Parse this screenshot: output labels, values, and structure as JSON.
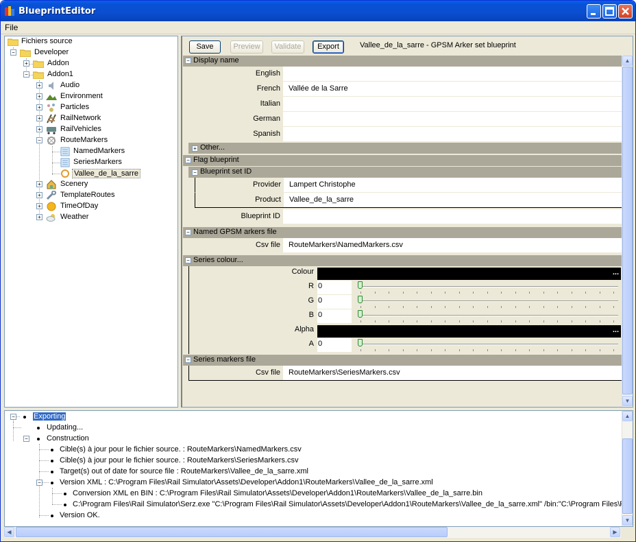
{
  "window": {
    "title": "BlueprintEditor"
  },
  "menu": {
    "file": "File"
  },
  "tree": {
    "root": "Fichiers source",
    "developer": "Developer",
    "addon": "Addon",
    "addon1": "Addon1",
    "items": [
      "Audio",
      "Environment",
      "Particles",
      "RailNetwork",
      "RailVehicles",
      "RouteMarkers"
    ],
    "route_children": [
      "NamedMarkers",
      "SeriesMarkers",
      "Vallee_de_la_sarre"
    ],
    "after": [
      "Scenery",
      "TemplateRoutes",
      "TimeOfDay",
      "Weather"
    ]
  },
  "toolbar": {
    "save": "Save",
    "preview": "Preview",
    "validate": "Validate",
    "export": "Export",
    "header": "Vallee_de_la_sarre - GPSM Arker set blueprint"
  },
  "grid": {
    "display_name": "Display name",
    "langs": [
      {
        "name": "English",
        "value": ""
      },
      {
        "name": "French",
        "value": "Vallée de la Sarre"
      },
      {
        "name": "Italian",
        "value": ""
      },
      {
        "name": "German",
        "value": ""
      },
      {
        "name": "Spanish",
        "value": ""
      }
    ],
    "other": "Other...",
    "flag": "Flag blueprint",
    "set_id": "Blueprint set ID",
    "provider_label": "Provider",
    "provider_value": "Lampert Christophe",
    "product_label": "Product",
    "product_value": "Vallee_de_la_sarre",
    "bpid_label": "Blueprint ID",
    "bpid_value": "",
    "named_file": "Named GPSM arkers file",
    "csv_label": "Csv file",
    "csv_named": "RouteMarkers\\NamedMarkers.csv",
    "series_colour": "Series colour...",
    "colour_label": "Colour",
    "dots": "...",
    "r_label": "R",
    "r_value": "0",
    "g_label": "G",
    "g_value": "0",
    "b_label": "B",
    "b_value": "0",
    "alpha_label": "Alpha",
    "a_label": "A",
    "a_value": "0",
    "series_file": "Series markers file",
    "csv_label2": "Csv file",
    "csv_series": "RouteMarkers\\SeriesMarkers.csv"
  },
  "log": [
    {
      "text": "Exporting",
      "level": 0
    },
    {
      "text": "Updating...",
      "level": 1
    },
    {
      "text": "Construction",
      "level": 1
    },
    {
      "text": "Cible(s) à jour pour le fichier source. : RouteMarkers\\NamedMarkers.csv",
      "level": 2
    },
    {
      "text": "Cible(s) à jour pour le fichier source. : RouteMarkers\\SeriesMarkers.csv",
      "level": 2
    },
    {
      "text": "Target(s) out of date for source file : RouteMarkers\\Vallee_de_la_sarre.xml",
      "level": 2
    },
    {
      "text": "Version XML : C:\\Program Files\\Rail Simulator\\Assets\\Developer\\Addon1\\RouteMarkers\\Vallee_de_la_sarre.xml",
      "level": 2
    },
    {
      "text": "Conversion XML en BIN : C:\\Program Files\\Rail Simulator\\Assets\\Developer\\Addon1\\RouteMarkers\\Vallee_de_la_sarre.bin",
      "level": 3
    },
    {
      "text": "C:\\Program Files\\Rail Simulator\\Serz.exe \"C:\\Program Files\\Rail Simulator\\Assets\\Developer\\Addon1\\RouteMarkers\\Vallee_de_la_sarre.xml\" /bin:\"C:\\Program Files\\Rail",
      "level": 3
    },
    {
      "text": "Version OK.",
      "level": 2
    }
  ]
}
